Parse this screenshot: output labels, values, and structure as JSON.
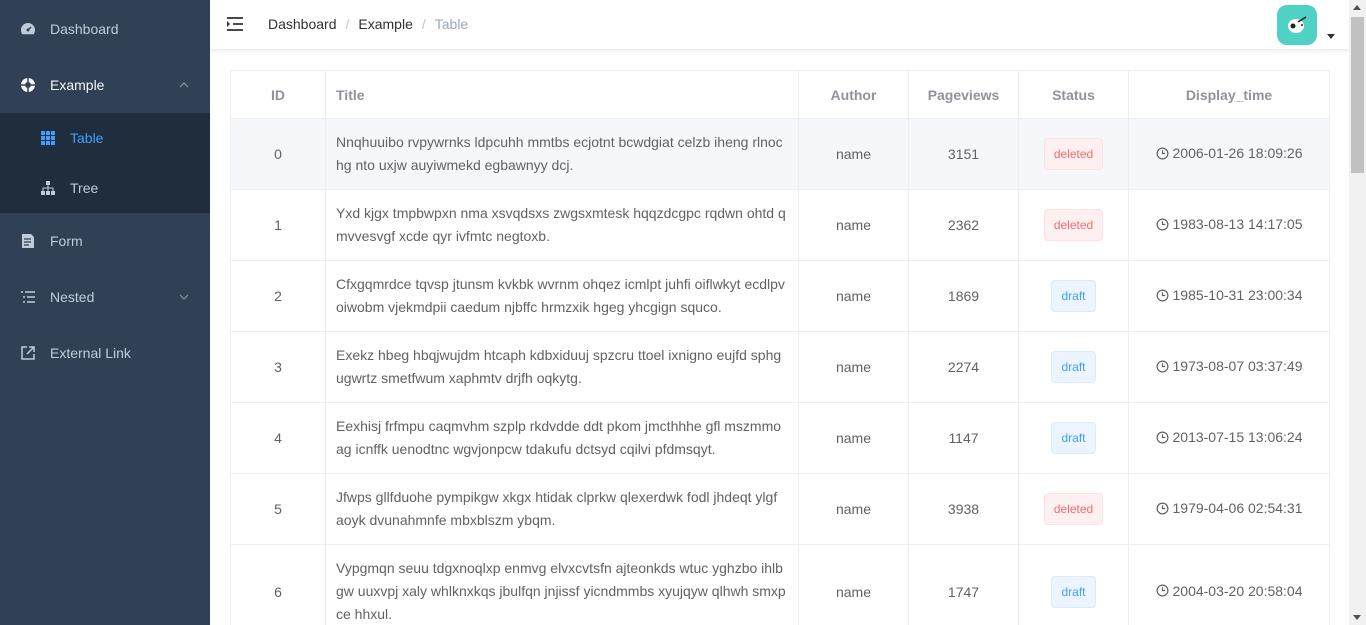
{
  "sidebar": {
    "items": [
      {
        "label": "Dashboard",
        "icon": "dashboard-icon"
      },
      {
        "label": "Example",
        "icon": "example-icon",
        "open": true,
        "children": [
          {
            "label": "Table",
            "icon": "table-icon",
            "active": true
          },
          {
            "label": "Tree",
            "icon": "tree-icon"
          }
        ]
      },
      {
        "label": "Form",
        "icon": "form-icon"
      },
      {
        "label": "Nested",
        "icon": "nested-icon"
      },
      {
        "label": "External Link",
        "icon": "external-link-icon"
      }
    ]
  },
  "breadcrumb": [
    "Dashboard",
    "Example",
    "Table"
  ],
  "breadcrumb_sep": "/",
  "table": {
    "headers": {
      "id": "ID",
      "title": "Title",
      "author": "Author",
      "pageviews": "Pageviews",
      "status": "Status",
      "display_time": "Display_time"
    },
    "rows": [
      {
        "id": "0",
        "title": "Nnqhuuibo rvpywrnks ldpcuhh mmtbs ecjotnt bcwdgiat celzb iheng rlnoc hg nto uxjw auyiwmekd egbawnyy dcj.",
        "author": "name",
        "pageviews": "3151",
        "status": "deleted",
        "display_time": "2006-01-26 18:09:26"
      },
      {
        "id": "1",
        "title": "Yxd kjgx tmpbwpxn nma xsvqdsxs zwgsxmtesk hqqzdcgpc rqdwn ohtd q mvvesvgf xcde qyr ivfmtc negtoxb.",
        "author": "name",
        "pageviews": "2362",
        "status": "deleted",
        "display_time": "1983-08-13 14:17:05"
      },
      {
        "id": "2",
        "title": "Cfxgqmrdce tqvsp jtunsm kvkbk wvrnm ohqez icmlpt juhfi oiflwkyt ecdlpv oiwobm vjekmdpii caedum njbffc hrmzxik hgeg yhcgign squco.",
        "author": "name",
        "pageviews": "1869",
        "status": "draft",
        "display_time": "1985-10-31 23:00:34"
      },
      {
        "id": "3",
        "title": "Exekz hbeg hbqjwujdm htcaph kdbxiduuj spzcru ttoel ixnigno eujfd sphg ugwrtz smetfwum xaphmtv drjfh oqkytg.",
        "author": "name",
        "pageviews": "2274",
        "status": "draft",
        "display_time": "1973-08-07 03:37:49"
      },
      {
        "id": "4",
        "title": "Eexhisj frfmpu caqmvhm szplp rkdvdde ddt pkom jmcthhhe gfl mszmmo ag icnffk uenodtnc wgvjonpcw tdakufu dctsyd cqilvi pfdmsqyt.",
        "author": "name",
        "pageviews": "1147",
        "status": "draft",
        "display_time": "2013-07-15 13:06:24"
      },
      {
        "id": "5",
        "title": "Jfwps gllfduohe pympikgw xkgx htidak clprkw qlexerdwk fodl jhdeqt ylgf aoyk dvunahmnfe mbxblszm ybqm.",
        "author": "name",
        "pageviews": "3938",
        "status": "deleted",
        "display_time": "1979-04-06 02:54:31"
      },
      {
        "id": "6",
        "title": "Vypgmqn seuu tdgxnoqlxp enmvg elvxcvtsfn ajteonkds wtuc yghzbo ihlb gw uuxvpj xaly whlknxkqs jbulfqn jnjissf yicndmmbs xyujqyw qlhwh smxp ce hhxul.",
        "author": "name",
        "pageviews": "1747",
        "status": "draft",
        "display_time": "2004-03-20 20:58:04"
      }
    ]
  },
  "colors": {
    "sidebar_bg": "#304156",
    "submenu_bg": "#1f2d3d",
    "accent": "#409eff",
    "deleted": "#f56c6c",
    "avatar_bg": "#4fd1c5"
  }
}
